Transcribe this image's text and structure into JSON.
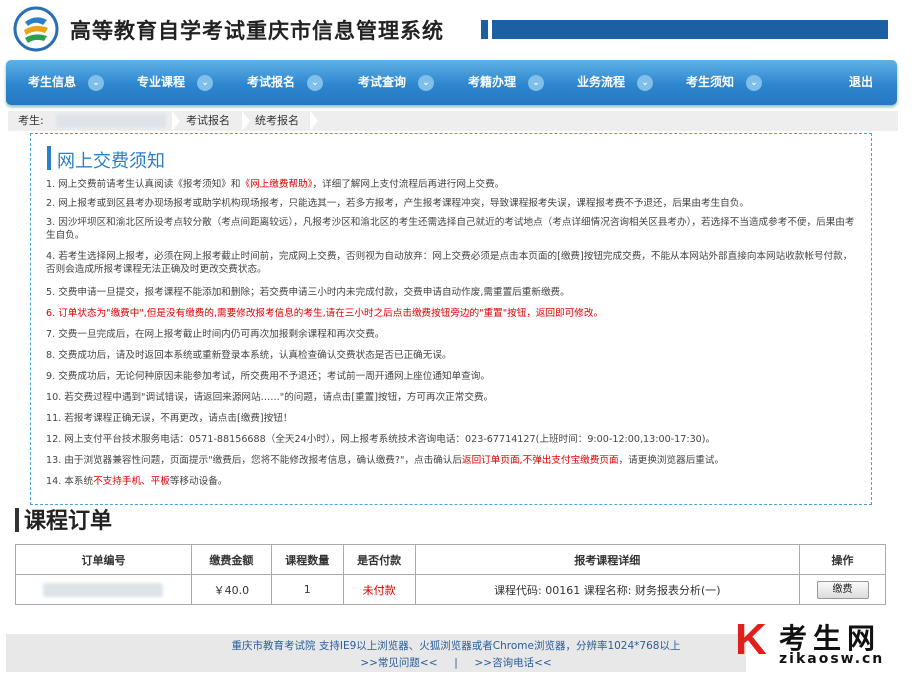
{
  "header": {
    "title": "高等教育自学考试重庆市信息管理系统",
    "brand_color": "#1d5fa3"
  },
  "nav": {
    "items": [
      {
        "label": "考生信息"
      },
      {
        "label": "专业课程"
      },
      {
        "label": "考试报名"
      },
      {
        "label": "考试查询"
      },
      {
        "label": "考籍办理"
      },
      {
        "label": "业务流程"
      },
      {
        "label": "考生须知"
      }
    ],
    "logout": "退出",
    "arrow_glyph": "⌄"
  },
  "breadcrumb": {
    "student_label": "考生:",
    "items": [
      "考试报名",
      "统考报名"
    ]
  },
  "notice": {
    "title": "网上交费须知",
    "rules": [
      [
        "1. 网上交费前请考生认真阅读《报考须知》和",
        "《网上缴费帮助》",
        "，详细了解网上支付流程后再进行网上交费。"
      ],
      [
        "2. 网上报考或到区县考办现场报考或助学机构现场报考，只能选其一，若多方报考，产生报考课程冲突，导致课程报考失误，课程报考费不予退还，后果由考生自负。"
      ],
      [
        "3. 因沙坪坝区和渝北区所设考点较分散（考点间距离较远），凡报考沙区和渝北区的考生还需选择自己就近的考试地点（考点详细情况咨询相关区县考办），若选择不当造成参考不便，后果由考生自负。"
      ],
      [
        "4. 若考生选择网上报考，必须在网上报考截止时间前，完成网上交费，否则视为自动放弃：网上交费必须是点击本页面的[缴费]按钮完成交费，不能从本网站外部直接向本网站收款帐号付款，否则会造成所报考课程无法正确及时更改交费状态。"
      ],
      [
        "5. 交费申请一旦提交，报考课程不能添加和删除；若交费申请三小时内未完成付款，交费申请自动作废,需重置后重新缴费。"
      ],
      [
        "6. 订单状态为\"缴费中\",但是没有缴费的,需要修改报考信息的考生,请在三小时之后点击缴费按钮旁边的\"重置\"按钮，返回即可修改。"
      ],
      [
        "7. 交费一旦完成后，在网上报考截止时间内仍可再次加报剩余课程和再次交费。"
      ],
      [
        "8. 交费成功后，请及时返回本系统或重新登录本系统，认真检查确认交费状态是否已正确无误。"
      ],
      [
        "9. 交费成功后，无论何种原因未能参加考试，所交费用不予退还；考试前一周开通网上座位通知单查询。"
      ],
      [
        "10. 若交费过程中遇到\"调试错误，请返回来源网站……\"的问题，请点击[重置]按钮，方可再次正常交费。"
      ],
      [
        "11. 若报考课程正确无误，不再更改，请点击[缴费]按钮！"
      ],
      [
        "12. 网上支付平台技术服务电话：0571-88156688（全天24小时），网上报考系统技术咨询电话：023-67714127(上班时间：9:00-12:00,13:00-17:30)。"
      ],
      [
        "13. 由于浏览器兼容性问题，页面提示\"缴费后，您将不能修改报考信息，确认缴费?\"，点击确认后",
        "返回订单页面,不弹出支付宝缴费页面",
        "，请更换浏览器后重试。"
      ],
      [
        "14. 本系统",
        "不支持手机、平板",
        "等移动设备。"
      ]
    ]
  },
  "orders": {
    "title": "课程订单",
    "columns": [
      "订单编号",
      "缴费金额",
      "课程数量",
      "是否付款",
      "报考课程详细",
      "操作"
    ],
    "rows": [
      {
        "amount": "￥40.0",
        "count": "1",
        "paid": "未付款",
        "detail": "课程代码: 00161   课程名称: 财务报表分析(一)",
        "action": "缴费"
      }
    ]
  },
  "footer": {
    "line1": "重庆市教育考试院     支持IE9以上浏览器、火狐浏览器或者Chrome浏览器，分辨率1024*768以上",
    "faq": ">>常见问题<<",
    "sep": "|",
    "phone": ">>咨询电话<<"
  },
  "watermark": {
    "letter": "K",
    "cn": "考生网",
    "url": "zikaosw.cn"
  },
  "colors": {
    "accent": "#2a7fc8",
    "alert": "#e00000",
    "nav_top": "#5fb1e6",
    "nav_bottom": "#2479c2"
  }
}
